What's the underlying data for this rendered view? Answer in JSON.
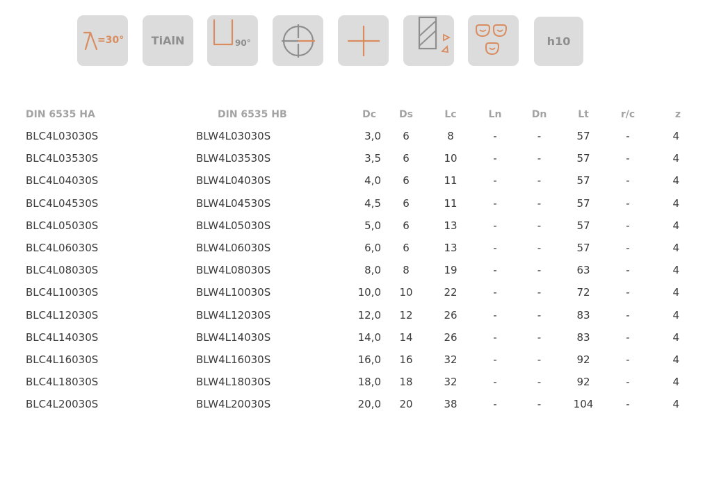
{
  "icons": [
    {
      "name": "helix-angle-icon",
      "label": "=30°"
    },
    {
      "name": "coating-icon",
      "label": "TiAlN"
    },
    {
      "name": "corner-90-icon",
      "label": "90°"
    },
    {
      "name": "center-cutting-icon"
    },
    {
      "name": "cross-icon"
    },
    {
      "name": "end-mill-direction-icon"
    },
    {
      "name": "materials-icon"
    },
    {
      "name": "tolerance-icon",
      "label": "h10"
    }
  ],
  "colors": {
    "tile_bg": "#dcdcdc",
    "accent": "#d98c5f",
    "icon_gray": "#8e8e8e",
    "header_text": "#a3a3a3",
    "body_text": "#3a3a3a"
  },
  "table": {
    "headers": [
      "DIN 6535 HA",
      "DIN 6535 HB",
      "Dc",
      "Ds",
      "Lc",
      "Ln",
      "Dn",
      "Lt",
      "r/c",
      "z"
    ],
    "rows": [
      [
        "BLC4L03030S",
        "BLW4L03030S",
        "3,0",
        "6",
        "8",
        "-",
        "-",
        "57",
        "-",
        "4"
      ],
      [
        "BLC4L03530S",
        "BLW4L03530S",
        "3,5",
        "6",
        "10",
        "-",
        "-",
        "57",
        "-",
        "4"
      ],
      [
        "BLC4L04030S",
        "BLW4L04030S",
        "4,0",
        "6",
        "11",
        "-",
        "-",
        "57",
        "-",
        "4"
      ],
      [
        "BLC4L04530S",
        "BLW4L04530S",
        "4,5",
        "6",
        "11",
        "-",
        "-",
        "57",
        "-",
        "4"
      ],
      [
        "BLC4L05030S",
        "BLW4L05030S",
        "5,0",
        "6",
        "13",
        "-",
        "-",
        "57",
        "-",
        "4"
      ],
      [
        "BLC4L06030S",
        "BLW4L06030S",
        "6,0",
        "6",
        "13",
        "-",
        "-",
        "57",
        "-",
        "4"
      ],
      [
        "BLC4L08030S",
        "BLW4L08030S",
        "8,0",
        "8",
        "19",
        "-",
        "-",
        "63",
        "-",
        "4"
      ],
      [
        "BLC4L10030S",
        "BLW4L10030S",
        "10,0",
        "10",
        "22",
        "-",
        "-",
        "72",
        "-",
        "4"
      ],
      [
        "BLC4L12030S",
        "BLW4L12030S",
        "12,0",
        "12",
        "26",
        "-",
        "-",
        "83",
        "-",
        "4"
      ],
      [
        "BLC4L14030S",
        "BLW4L14030S",
        "14,0",
        "14",
        "26",
        "-",
        "-",
        "83",
        "-",
        "4"
      ],
      [
        "BLC4L16030S",
        "BLW4L16030S",
        "16,0",
        "16",
        "32",
        "-",
        "-",
        "92",
        "-",
        "4"
      ],
      [
        "BLC4L18030S",
        "BLW4L18030S",
        "18,0",
        "18",
        "32",
        "-",
        "-",
        "92",
        "-",
        "4"
      ],
      [
        "BLC4L20030S",
        "BLW4L20030S",
        "20,0",
        "20",
        "38",
        "-",
        "-",
        "104",
        "-",
        "4"
      ]
    ]
  }
}
